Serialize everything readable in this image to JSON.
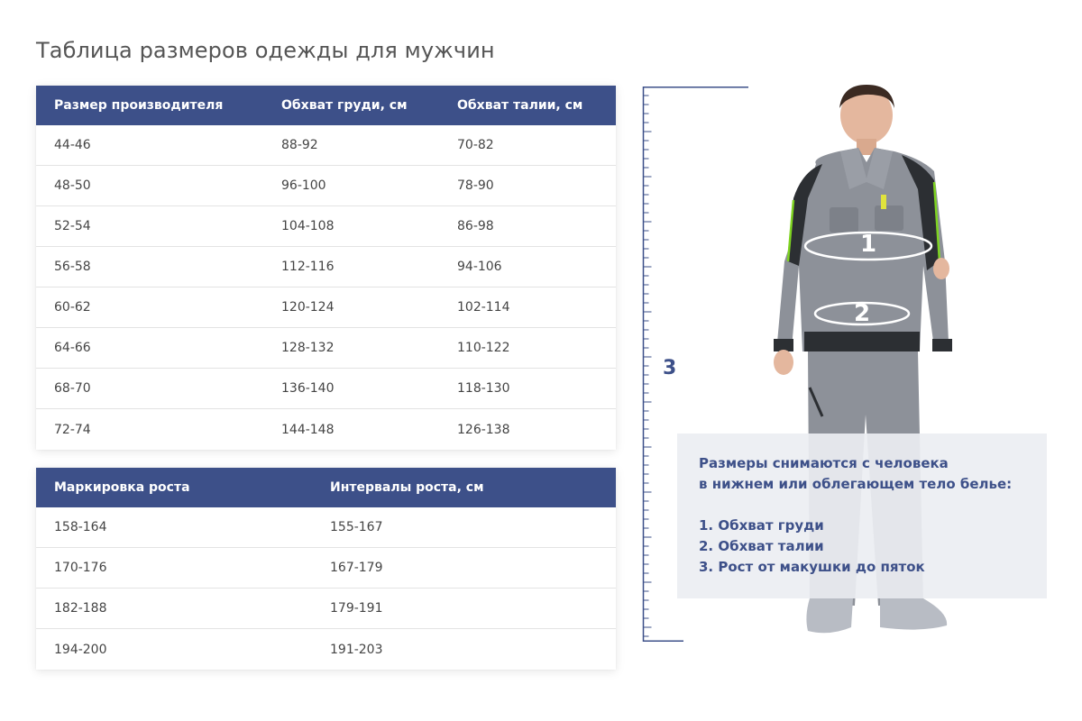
{
  "page_title": "Таблица размеров одежды для мужчин",
  "sizes_table": {
    "headers": [
      "Размер производителя",
      "Обхват груди, см",
      "Обхват талии, см"
    ],
    "rows": [
      [
        "44-46",
        "88-92",
        "70-82"
      ],
      [
        "48-50",
        "96-100",
        "78-90"
      ],
      [
        "52-54",
        "104-108",
        "86-98"
      ],
      [
        "56-58",
        "112-116",
        "94-106"
      ],
      [
        "60-62",
        "120-124",
        "102-114"
      ],
      [
        "64-66",
        "128-132",
        "110-122"
      ],
      [
        "68-70",
        "136-140",
        "118-130"
      ],
      [
        "72-74",
        "144-148",
        "126-138"
      ]
    ]
  },
  "height_table": {
    "headers": [
      "Маркировка роста",
      "Интервалы роста, см"
    ],
    "rows": [
      [
        "158-164",
        "155-167"
      ],
      [
        "170-176",
        "167-179"
      ],
      [
        "182-188",
        "179-191"
      ],
      [
        "194-200",
        "191-203"
      ]
    ]
  },
  "figure": {
    "ruler_label": "3",
    "ring_1_label": "1",
    "ring_2_label": "2"
  },
  "info": {
    "line_1": "Размеры снимаются с человека",
    "line_2": "в нижнем или облегающем тело белье:",
    "item_1": "1. Обхват груди",
    "item_2": "2. Обхват талии",
    "item_3": "3. Рост от макушки до пяток"
  },
  "colors": {
    "header_bg": "#3d5089",
    "accent_text": "#3d5089",
    "info_bg": "#eceef2"
  }
}
